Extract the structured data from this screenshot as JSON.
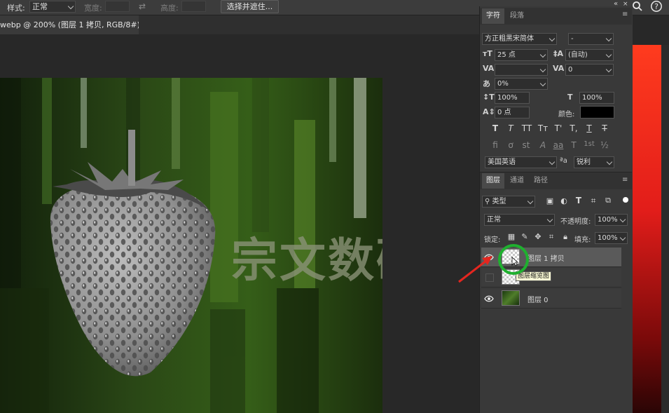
{
  "options_bar": {
    "style_label": "样式:",
    "style_value": "正常",
    "width_label": "宽度:",
    "height_label": "高度:",
    "select_mask_button": "选择并遮住..."
  },
  "document_tab": {
    "title": "webp @ 200% (图层 1 拷贝, RGB/8#) *",
    "close": "×"
  },
  "canvas": {
    "watermark": "宗文数码"
  },
  "character_panel": {
    "tabs": [
      "字符",
      "段落"
    ],
    "font_family": "方正粗黑宋简体",
    "font_style": "-",
    "font_size": "25 点",
    "leading": "(自动)",
    "kerning": "",
    "tracking": "0",
    "tsume": "0%",
    "vertical_scale": "100%",
    "horizontal_scale": "100%",
    "baseline_shift": "0 点",
    "color_label": "颜色:",
    "color_value": "#000000",
    "style_buttons": [
      "T",
      "T",
      "TT",
      "Tт",
      "T'",
      "T,",
      "T",
      "T"
    ],
    "opentype_buttons": [
      "fi",
      "ơ",
      "st",
      "A",
      "aa",
      "T",
      "1st",
      "½"
    ],
    "language": "美国英语",
    "aa_label": "ªa",
    "antialias": "锐利"
  },
  "layers_panel": {
    "tabs": [
      "图层",
      "通道",
      "路径"
    ],
    "filter_kind": "类型",
    "blend_mode": "正常",
    "opacity_label": "不透明度:",
    "opacity_value": "100%",
    "lock_label": "锁定:",
    "fill_label": "填充:",
    "fill_value": "100%",
    "layers": [
      {
        "name": "图层 1 拷贝",
        "visible": true,
        "selected": true
      },
      {
        "name": "",
        "visible": false,
        "selected": false
      },
      {
        "name": "图层 0",
        "visible": true,
        "selected": false
      }
    ],
    "tooltip": "图层缩览图"
  },
  "colors": {
    "accent_circle": "#1fb02f",
    "arrow": "#e4261f"
  }
}
